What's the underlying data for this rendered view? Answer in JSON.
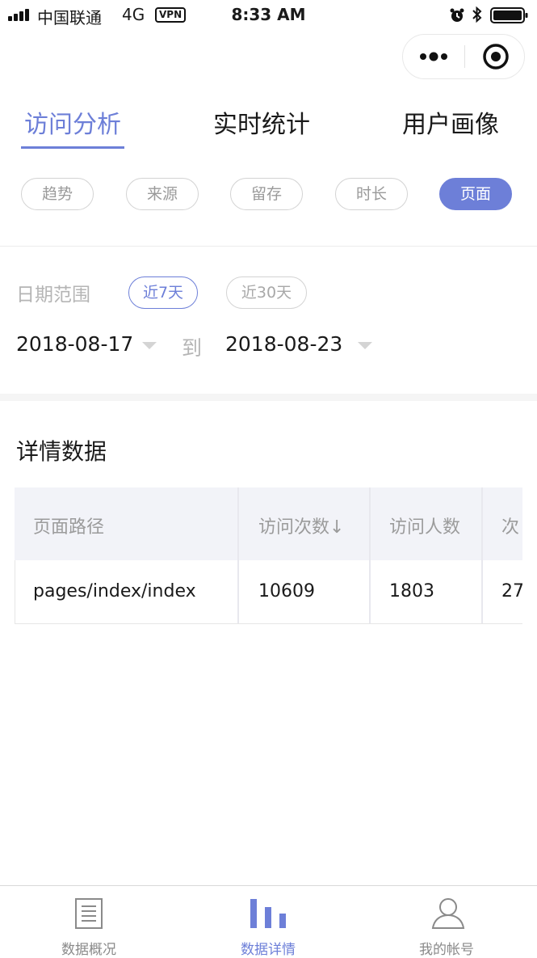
{
  "status_bar": {
    "carrier": "中国联通",
    "network": "4G",
    "vpn": "VPN",
    "time": "8:33 AM"
  },
  "main_tabs": [
    {
      "label": "访问分析",
      "active": true
    },
    {
      "label": "实时统计",
      "active": false
    },
    {
      "label": "用户画像",
      "active": false
    }
  ],
  "sub_tabs": [
    {
      "label": "趋势",
      "active": false
    },
    {
      "label": "来源",
      "active": false
    },
    {
      "label": "留存",
      "active": false
    },
    {
      "label": "时长",
      "active": false
    },
    {
      "label": "页面",
      "active": true
    }
  ],
  "date_filter": {
    "label": "日期范围",
    "ranges": [
      {
        "label": "近7天",
        "active": true
      },
      {
        "label": "近30天",
        "active": false
      }
    ],
    "start_date": "2018-08-17",
    "to_label": "到",
    "end_date": "2018-08-23"
  },
  "detail": {
    "title": "详情数据",
    "columns": [
      "页面路径",
      "访问次数↓",
      "访问人数",
      "次"
    ],
    "rows": [
      [
        "pages/index/index",
        "10609",
        "1803",
        "27"
      ]
    ]
  },
  "bottom_nav": [
    {
      "label": "数据概况",
      "icon": "document-list-icon",
      "active": false
    },
    {
      "label": "数据详情",
      "icon": "bar-chart-icon",
      "active": true
    },
    {
      "label": "我的帐号",
      "icon": "user-icon",
      "active": false
    }
  ],
  "colors": {
    "accent": "#6d7fd8",
    "muted": "#9b9b9b"
  }
}
